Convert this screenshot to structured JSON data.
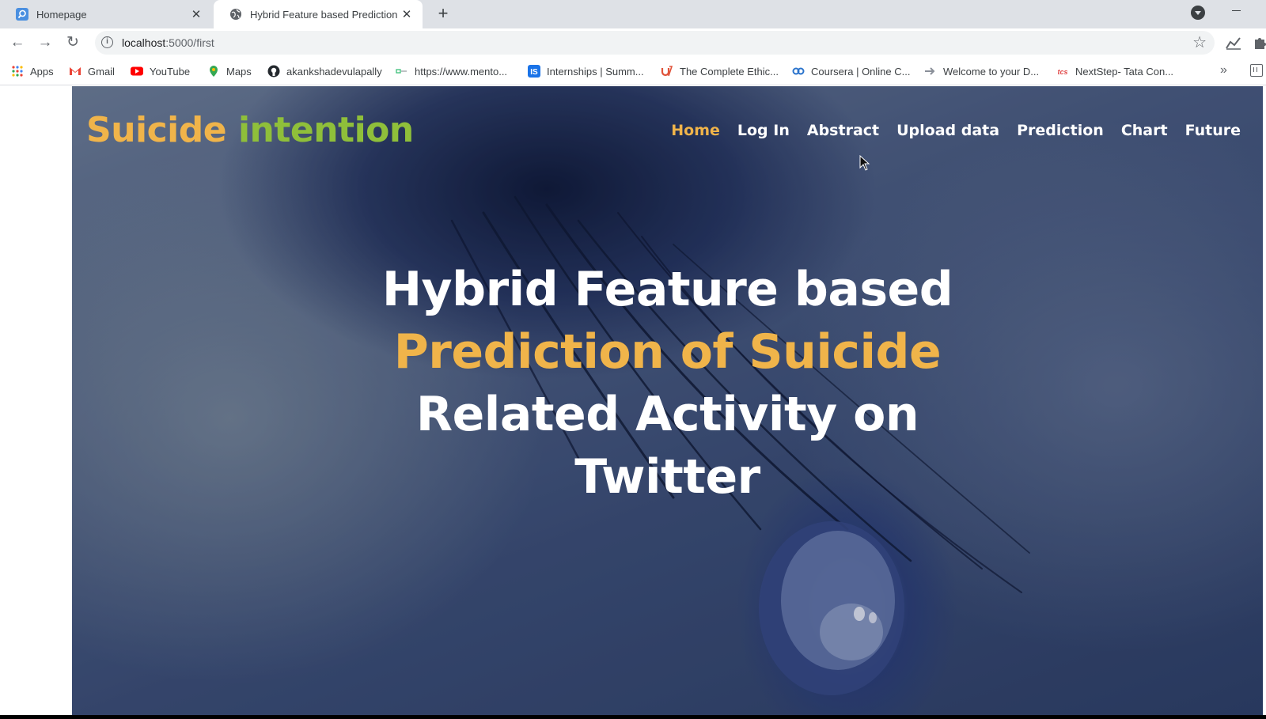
{
  "browser": {
    "tabs": [
      {
        "title": "Homepage",
        "icon": "search-favicon"
      },
      {
        "title": "Hybrid Feature based Prediction",
        "icon": "globe-favicon"
      }
    ],
    "address": {
      "host": "localhost",
      "path": ":5000/first"
    },
    "bookmarks": [
      {
        "label": "Apps",
        "icon": "apps-grid-icon"
      },
      {
        "label": "Gmail",
        "icon": "gmail-icon"
      },
      {
        "label": "YouTube",
        "icon": "youtube-icon"
      },
      {
        "label": "Maps",
        "icon": "maps-icon"
      },
      {
        "label": "akankshadevulapally",
        "icon": "github-icon"
      },
      {
        "label": "https://www.mento...",
        "icon": "link-icon"
      },
      {
        "label": "Internships | Summ...",
        "icon": "internshala-icon"
      },
      {
        "label": "The Complete Ethic...",
        "icon": "udemy-icon"
      },
      {
        "label": "Coursera | Online C...",
        "icon": "coursera-icon"
      },
      {
        "label": "Welcome to your D...",
        "icon": "arrow-icon"
      },
      {
        "label": "NextStep- Tata Con...",
        "icon": "tcs-icon"
      }
    ],
    "more_bookmarks": "»"
  },
  "site": {
    "brand": {
      "word1": "Suicide",
      "word2": "intention"
    },
    "nav": [
      {
        "label": "Home",
        "active": true
      },
      {
        "label": "Log In"
      },
      {
        "label": "Abstract"
      },
      {
        "label": "Upload data"
      },
      {
        "label": "Prediction"
      },
      {
        "label": "Chart"
      },
      {
        "label": "Future"
      }
    ],
    "headline": {
      "line1": "Hybrid Feature based",
      "line2": "Prediction of Suicide",
      "line3": "Related Activity on",
      "line4": "Twitter"
    }
  },
  "colors": {
    "accent": "#f0b44a",
    "brand_green": "#8fbf3a",
    "tabstrip": "#dee1e6"
  }
}
